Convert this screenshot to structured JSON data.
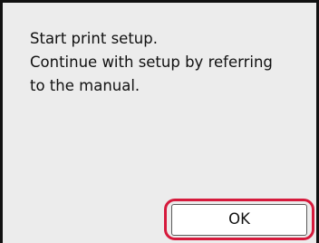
{
  "dialog": {
    "message_lines": [
      "Start print setup.",
      "Continue with setup by referring",
      "to the manual."
    ],
    "ok_label": "OK"
  },
  "colors": {
    "background": "#ececec",
    "highlight": "#d61a3c"
  }
}
